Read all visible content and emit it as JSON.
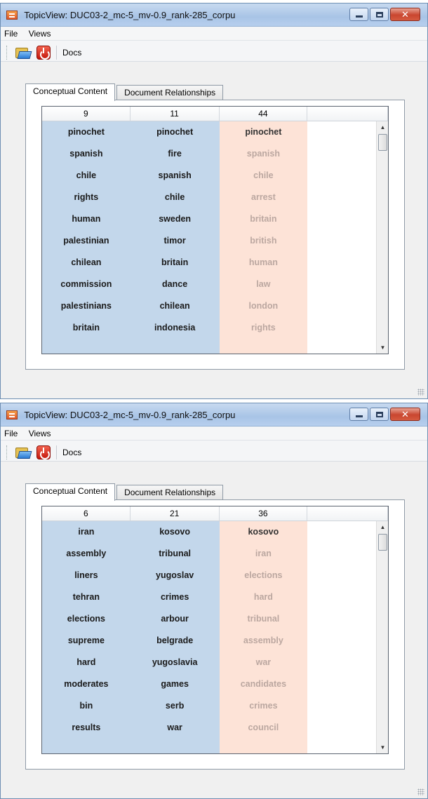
{
  "windows": [
    {
      "title": "TopicView: DUC03-2_mc-5_mv-0.9_rank-285_corpu",
      "menu": [
        "File",
        "Views"
      ],
      "toolbar": {
        "docs_label": "Docs"
      },
      "tabs": [
        "Conceptual Content",
        "Document Relationships"
      ],
      "table": {
        "headers": [
          "9",
          "11",
          "44",
          ""
        ],
        "columns": [
          [
            "pinochet",
            "spanish",
            "chile",
            "rights",
            "human",
            "palestinian",
            "chilean",
            "commission",
            "palestinians",
            "britain"
          ],
          [
            "pinochet",
            "fire",
            "spanish",
            "chile",
            "sweden",
            "timor",
            "britain",
            "dance",
            "chilean",
            "indonesia"
          ],
          [
            "pinochet",
            "spanish",
            "chile",
            "arrest",
            "britain",
            "british",
            "human",
            "law",
            "london",
            "rights"
          ]
        ]
      }
    },
    {
      "title": "TopicView: DUC03-2_mc-5_mv-0.9_rank-285_corpu",
      "menu": [
        "File",
        "Views"
      ],
      "toolbar": {
        "docs_label": "Docs"
      },
      "tabs": [
        "Conceptual Content",
        "Document Relationships"
      ],
      "table": {
        "headers": [
          "6",
          "21",
          "36",
          ""
        ],
        "columns": [
          [
            "iran",
            "assembly",
            "liners",
            "tehran",
            "elections",
            "supreme",
            "hard",
            "moderates",
            "bin",
            "results"
          ],
          [
            "kosovo",
            "tribunal",
            "yugoslav",
            "crimes",
            "arbour",
            "belgrade",
            "yugoslavia",
            "games",
            "serb",
            "war"
          ],
          [
            "kosovo",
            "iran",
            "elections",
            "hard",
            "tribunal",
            "assembly",
            "war",
            "candidates",
            "crimes",
            "council"
          ]
        ]
      }
    }
  ],
  "colors": {
    "topic_column_bg": "#c3d7eb",
    "comparison_column_bg": "#fde3d7",
    "close_button": "#c9462f"
  },
  "icons": {
    "app": "app-icon",
    "open": "folder-open-icon",
    "quit": "power-icon",
    "scroll_up": "scroll-up-arrow-icon",
    "scroll_down": "scroll-down-arrow-icon"
  }
}
